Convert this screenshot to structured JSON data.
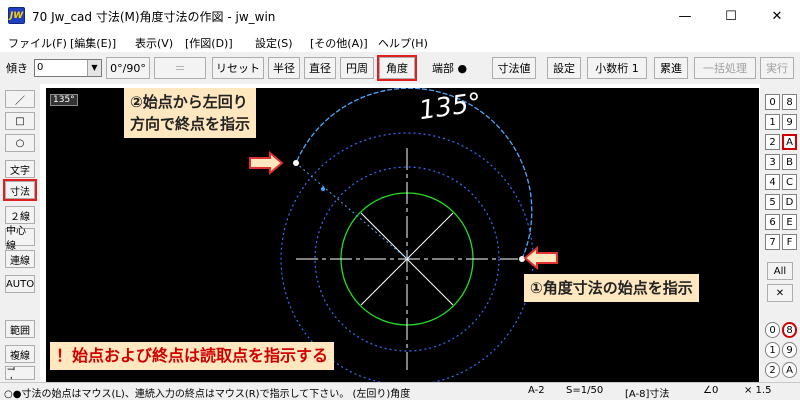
{
  "window": {
    "icon_text": "JW",
    "title": "70 Jw_cad 寸法(M)角度寸法の作図 - jw_win",
    "minimize_glyph": "—",
    "maximize_glyph": "☐",
    "close_glyph": "✕"
  },
  "menu": [
    "ファイル(F)",
    "[編集(E)]",
    "表示(V)",
    "[作図(D)]",
    "設定(S)",
    "[その他(A)]",
    "ヘルプ(H)"
  ],
  "toolbar": {
    "tilt_label": "傾き",
    "tilt_value": "0",
    "angle_toggle": "0°/90°",
    "equals": "＝",
    "reset": "リセット",
    "radius": "半径",
    "diameter": "直径",
    "circumference": "円周",
    "angle": "角度",
    "endpoint_label": "端部 ●",
    "dim_value": "寸法値",
    "settings": "設定",
    "decimals": "小数桁 1",
    "cumulative": "累進",
    "batch": "一括処理",
    "execute": "実行"
  },
  "left_toolbar": [
    "／",
    "□",
    "○",
    "文字",
    "寸法",
    "２線",
    "中心線",
    "連線",
    "AUTO",
    "範囲",
    "複線",
    "コーナー"
  ],
  "canvas": {
    "scale_tag": "135°",
    "angle_label": "135°",
    "annotation_end": [
      "②始点から左回り",
      "方向で終点を指示"
    ],
    "annotation_start": "①角度寸法の始点を指示",
    "annotation_note": "！始点および終点は読取点を指示する",
    "colors": {
      "background": "#000000",
      "arc": "#4aa8ff",
      "green_circle": "#22dd22",
      "dotted": "#3b6cff",
      "arrow": "#e03030"
    }
  },
  "layers": {
    "left": [
      "0",
      "1",
      "2",
      "3",
      "4",
      "5",
      "6",
      "7"
    ],
    "right": [
      "8",
      "9",
      "A",
      "B",
      "C",
      "D",
      "E",
      "F"
    ],
    "all": "All",
    "close": "✕",
    "groups_left": [
      "0",
      "1",
      "2"
    ],
    "groups_right": [
      "8",
      "9",
      "A"
    ]
  },
  "status": {
    "message": "○●寸法の始点はマウス(L)、連続入力の終点はマウス(R)で指示して下さい。 (左回り)角度",
    "paper": "A-2",
    "scale": "S=1/50",
    "layer": "[A-8]寸法",
    "angle": "∠0",
    "zoom": "× 1.5"
  }
}
